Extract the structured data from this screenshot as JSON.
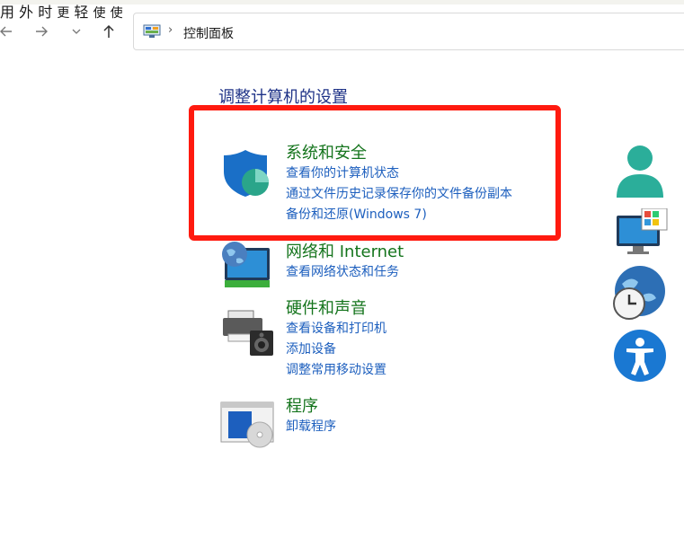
{
  "address": {
    "breadcrumb_sep": "›",
    "current": "控制面板"
  },
  "page_title": "调整计算机的设置",
  "categories": [
    {
      "title": "系统和安全",
      "links": [
        "查看你的计算机状态",
        "通过文件历史记录保存你的文件备份副本",
        "备份和还原(Windows 7)"
      ]
    },
    {
      "title": "网络和 Internet",
      "links": [
        "查看网络状态和任务"
      ]
    },
    {
      "title": "硬件和声音",
      "links": [
        "查看设备和打印机",
        "添加设备",
        "调整常用移动设置"
      ]
    },
    {
      "title": "程序",
      "links": [
        "卸载程序"
      ]
    }
  ],
  "right_fragments": [
    "用",
    "外",
    "时",
    "更",
    "轻",
    "使",
    "使"
  ],
  "colors": {
    "category_title": "#14741c",
    "link": "#1d5fbe",
    "title": "#1e3287",
    "highlight": "#ff1a0f"
  }
}
